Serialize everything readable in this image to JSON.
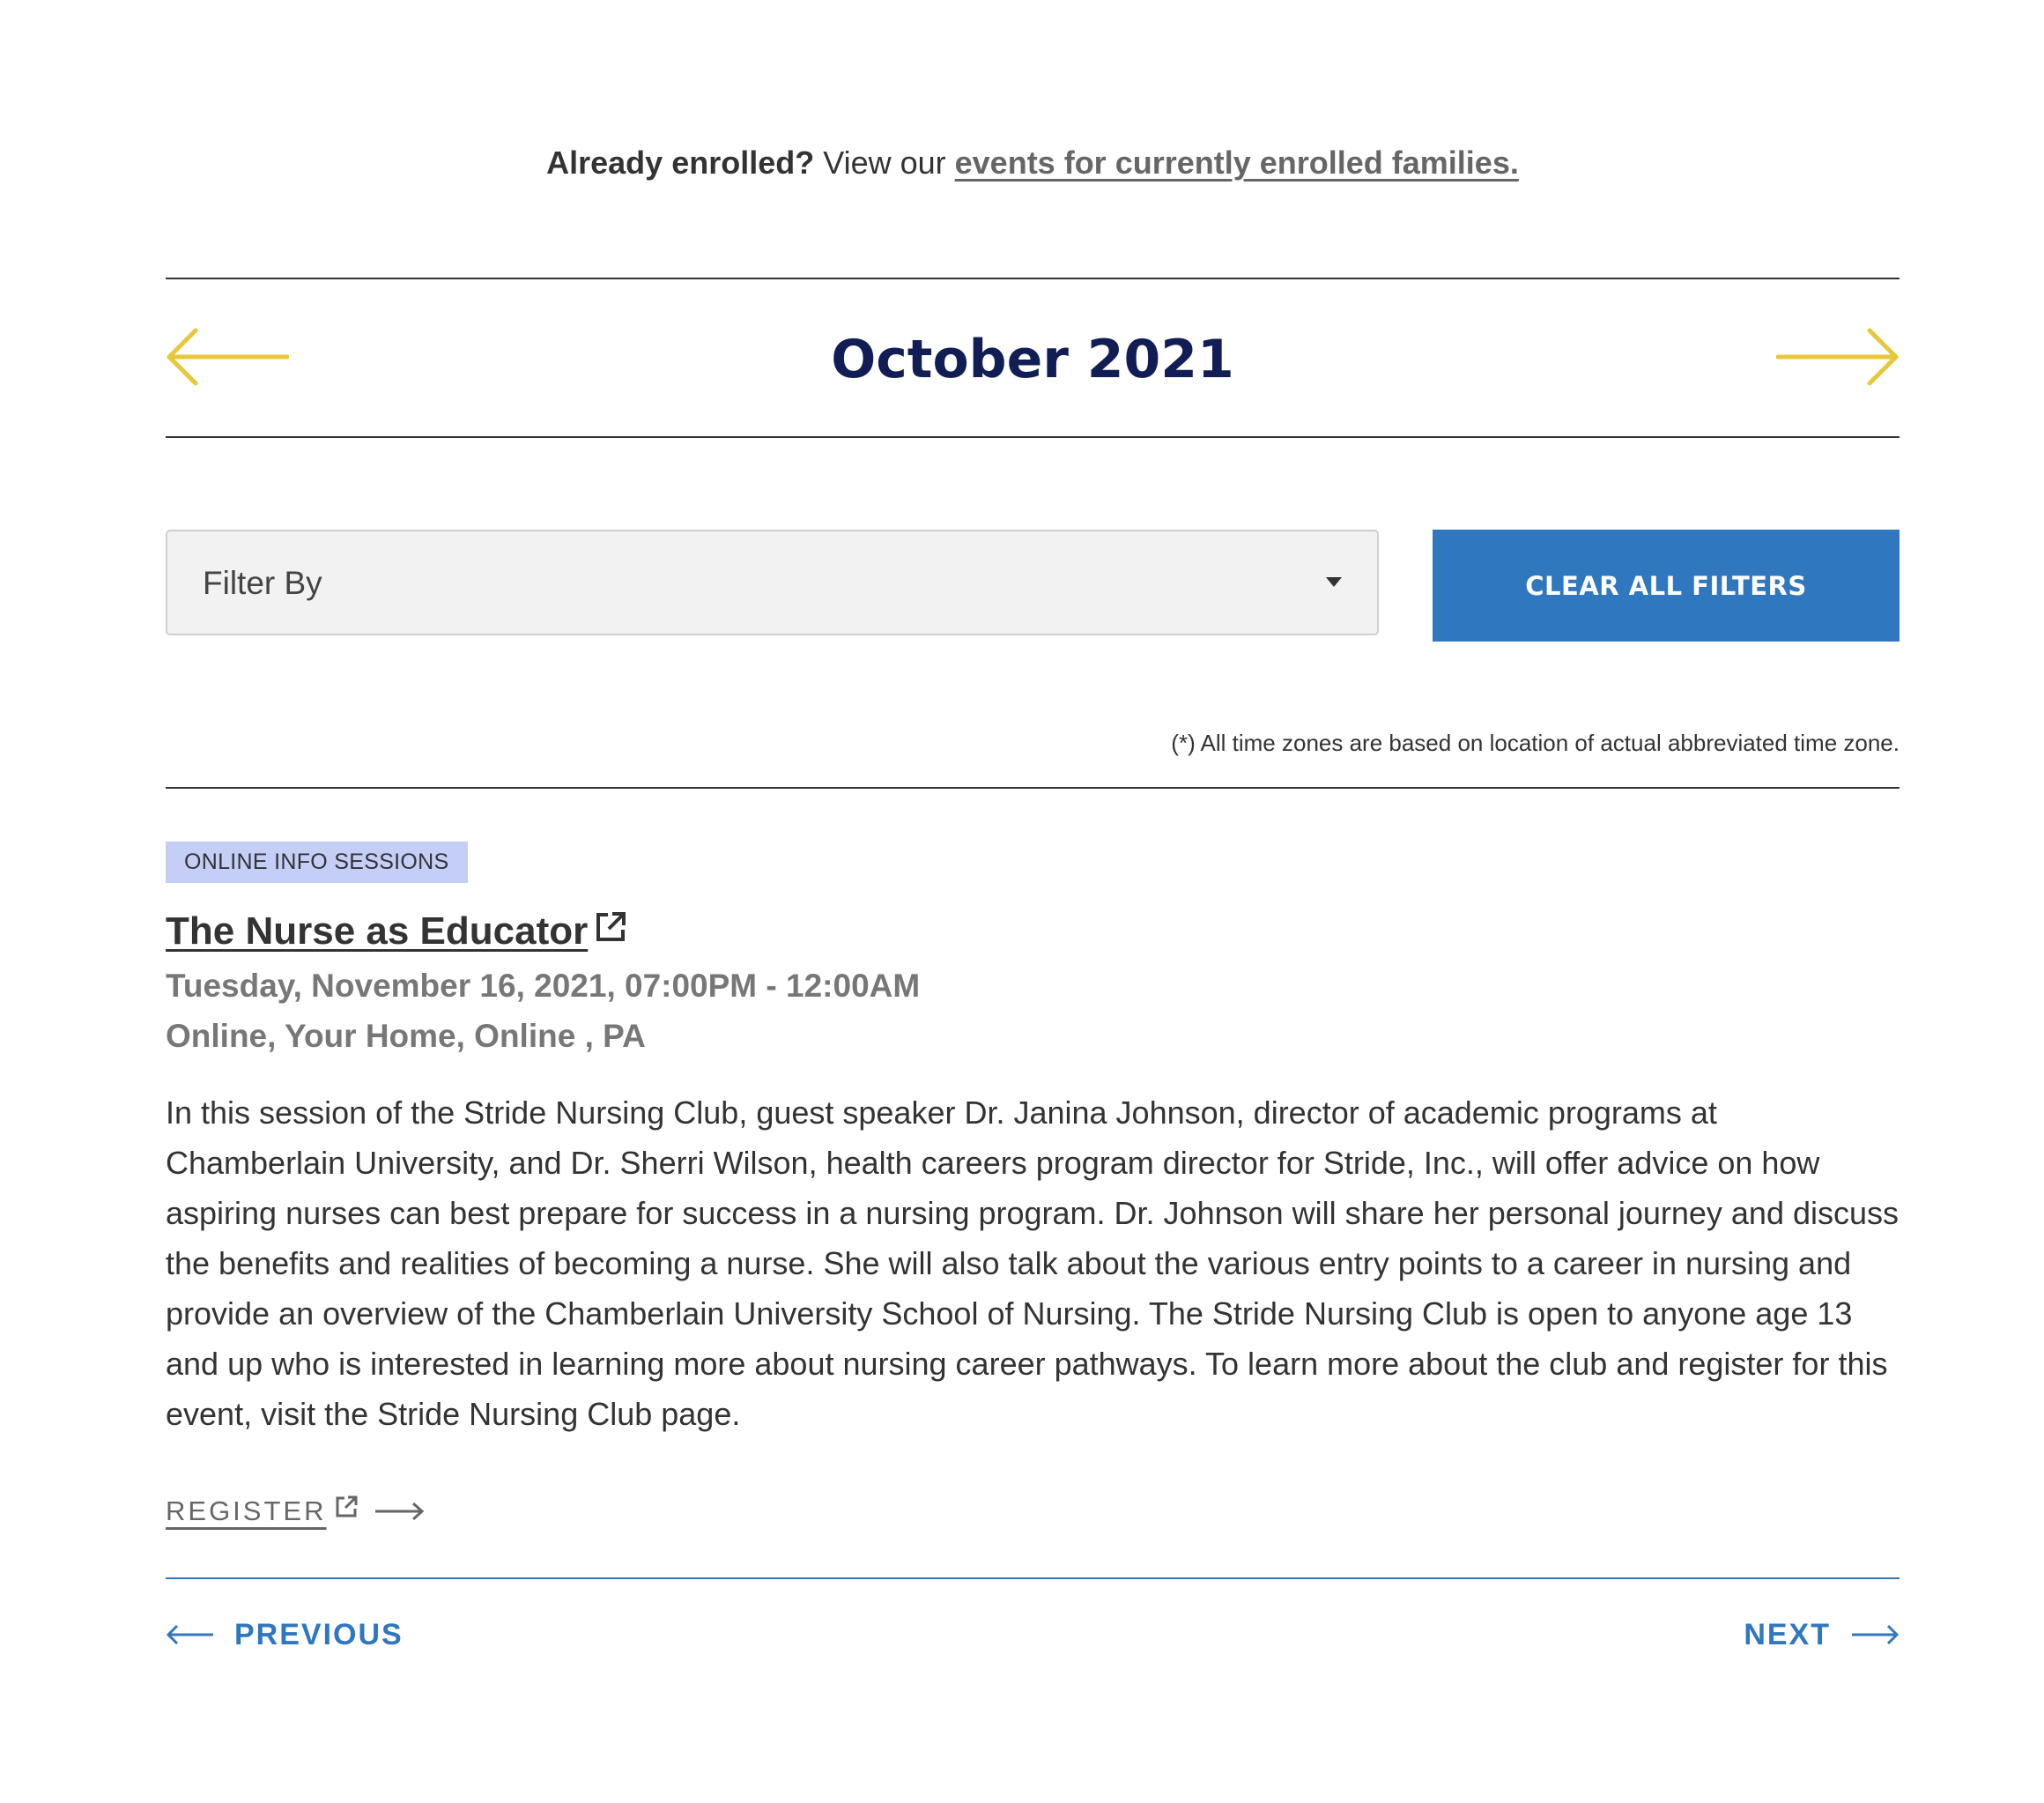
{
  "enrolled": {
    "prefix": "Already enrolled?",
    "middle": " View our ",
    "link": "events for currently enrolled families."
  },
  "calendar": {
    "month_title": "October 2021"
  },
  "filters": {
    "filter_label": "Filter By",
    "clear_label": "CLEAR ALL FILTERS",
    "timezone_note": "(*) All time zones are based on location of actual abbreviated time zone."
  },
  "event": {
    "category": "ONLINE INFO SESSIONS",
    "title": "The Nurse as Educator",
    "datetime": "Tuesday, November 16, 2021, 07:00PM - 12:00AM",
    "location": "Online, Your Home, Online , PA",
    "description": "In this session of the Stride Nursing Club, guest speaker Dr. Janina Johnson, director of academic programs at Chamberlain University, and Dr. Sherri Wilson, health careers program director for Stride, Inc., will offer advice on how aspiring nurses can best prepare for success in a nursing program. Dr. Johnson will share her personal journey and discuss the benefits and realities of becoming a nurse. She will also talk about the various entry points to a career in nursing and provide an overview of the Chamberlain University School of Nursing. The Stride Nursing Club is open to anyone age 13 and up who is interested in learning more about nursing career pathways. To learn more about the club and register for this event, visit the Stride Nursing Club page.",
    "register_label": "REGISTER"
  },
  "pager": {
    "previous_label": "PREVIOUS",
    "next_label": "NEXT"
  },
  "icons": {
    "month_prev": "arrow-left-icon",
    "month_next": "arrow-right-icon",
    "external": "external-link-icon",
    "dropdown": "caret-down-icon"
  },
  "colors": {
    "navy": "#111d55",
    "accent_yellow": "#e8c83a",
    "primary_blue": "#2f77be",
    "badge_bg": "#c5cef7",
    "muted_text": "#777777"
  }
}
